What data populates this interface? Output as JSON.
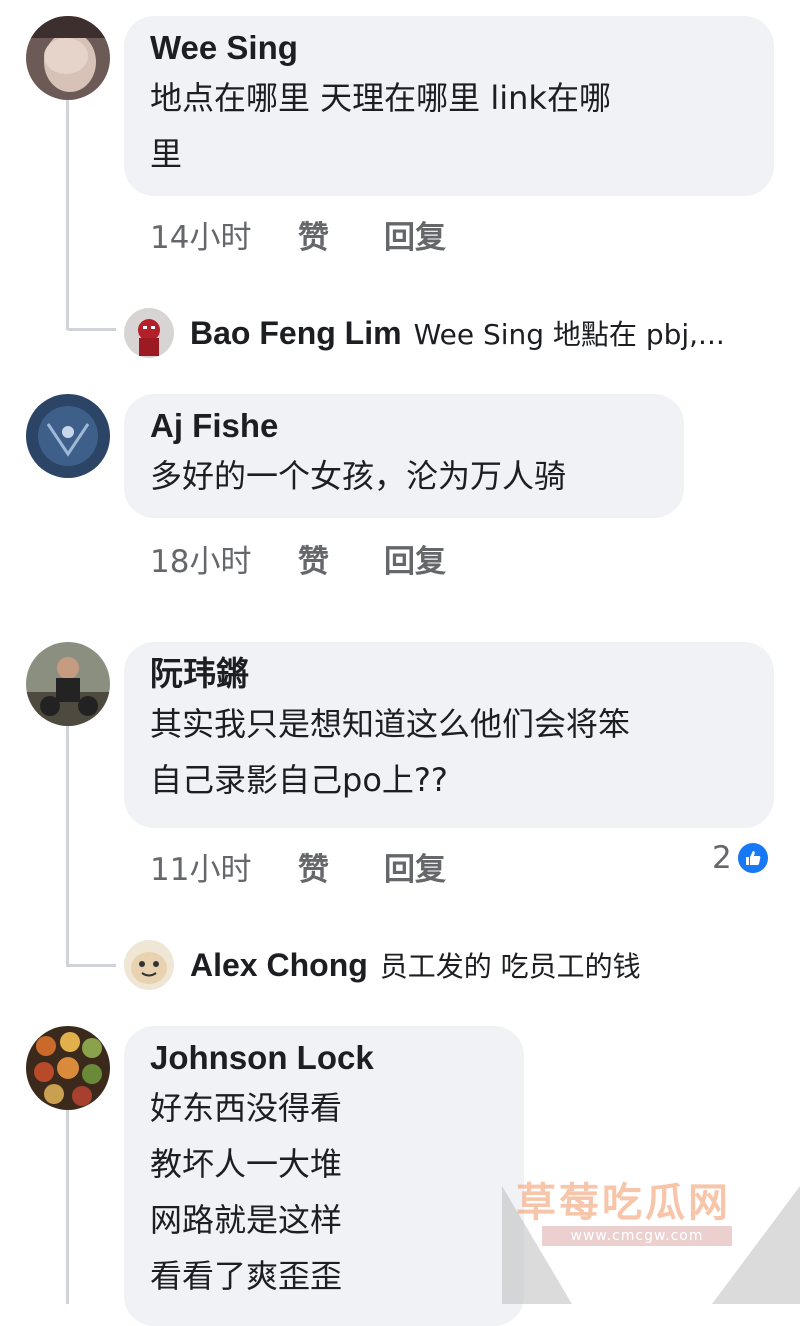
{
  "comments": [
    {
      "author": "Wee Sing",
      "text": "地点在哪里 天理在哪里  link在哪\n里",
      "time": "14小时",
      "like": "赞",
      "reply": "回复",
      "reply_preview": {
        "author": "Bao Feng Lim",
        "text": "Wee Sing 地點在 pbj,..."
      }
    },
    {
      "author": "Aj Fishe",
      "text": "多好的一个女孩，沦为万人骑",
      "time": "18小时",
      "like": "赞",
      "reply": "回复"
    },
    {
      "author": "阮玮鏘",
      "text": "其实我只是想知道这么他们会将笨\n自己录影自己po上??",
      "time": "11小时",
      "like": "赞",
      "reply": "回复",
      "reaction_count": "2",
      "reply_preview": {
        "author": "Alex Chong",
        "text": "员工发的 吃员工的钱"
      }
    },
    {
      "author": "Johnson Lock",
      "text": "好东西没得看\n教坏人一大堆\n网路就是这样\n看看了爽歪歪"
    }
  ],
  "watermark": {
    "name": "草莓吃瓜网",
    "url": "www.cmcgw.com"
  },
  "colors": {
    "bubble": "#f0f2f5",
    "secondary_text": "#65676b",
    "like_blue": "#1877f2"
  }
}
